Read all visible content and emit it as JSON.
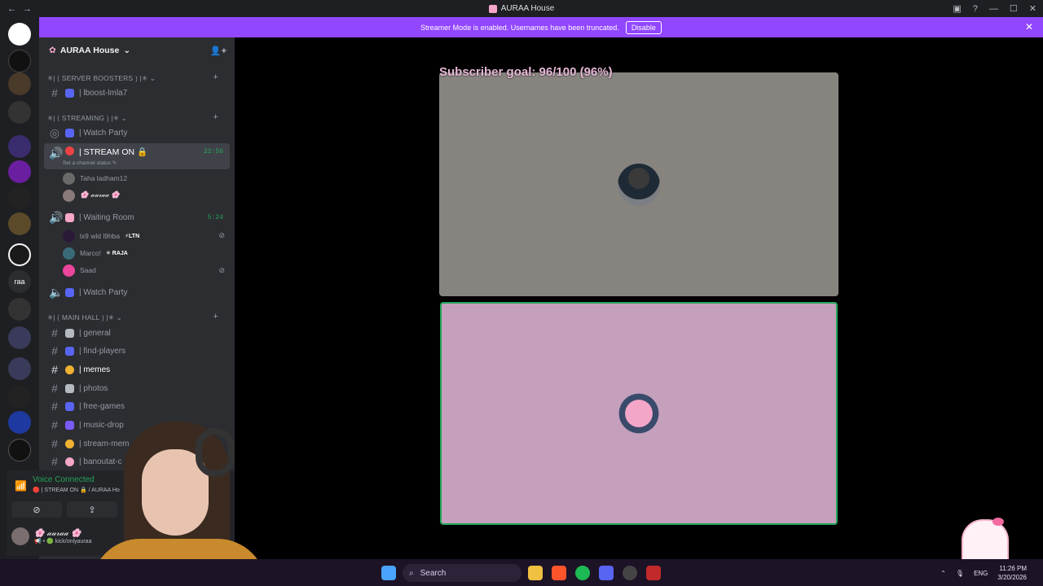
{
  "window": {
    "title": "AURAA House"
  },
  "banner": {
    "text": "Streamer Mode is enabled. Usernames have been truncated.",
    "button": "Disable"
  },
  "server": {
    "name": "AURAA House"
  },
  "categories": [
    {
      "label": "✳| ⟮ SERVER BOOSTERS ⟯ |✳"
    },
    {
      "label": "✳| ⟮ STREAMING ⟯ |✳"
    },
    {
      "label": "✳| ⟮ MAIN HALL ⟯ |✳"
    }
  ],
  "channels": {
    "boost": "| lboost-lmla7",
    "watch1": "| Watch Party",
    "stream": "| STREAM ON 🔒",
    "stream_time": "22:56",
    "stream_status": "Set a channel status ✎",
    "waiting": "| Waiting Room",
    "waiting_time": "5:24",
    "watch2": "| Watch Party",
    "general": "| general",
    "find": "| find-players",
    "memes": "| memes",
    "photos": "| photos",
    "free": "| free-games",
    "music": "| music-drop",
    "streammem": "| stream-mem",
    "banoutat": "| banoutat-c"
  },
  "users": {
    "u1": "Taha ladham12",
    "u2": "🌸 𝒶𝓊𝓇𝒶𝒶 🌸",
    "u3": "lx9 wld l9hba",
    "u3tag": "⚡LTN",
    "u4": "Marco!",
    "u4tag": "✳ RAJA",
    "u5": "Saad"
  },
  "voice": {
    "status": "Voice Connected",
    "location": "🔴 | STREAM ON 🔒 / AURAA Ho",
    "me": "🌸 𝒶𝓊𝓇𝒶𝒶 🌸",
    "me_status": "📢 • 🟢 kick/onlyauraa"
  },
  "stage": {
    "goal": "Subscriber goal: 96/100 (96%)"
  },
  "taskbar": {
    "search": "Search",
    "lang": "ENG",
    "time": "11:26 PM",
    "date": "3/20/2026"
  },
  "colors": {
    "accent": "#9146ff",
    "online": "#23a559",
    "tile_active": "#c4a0bd",
    "tile_idle": "#878480"
  }
}
